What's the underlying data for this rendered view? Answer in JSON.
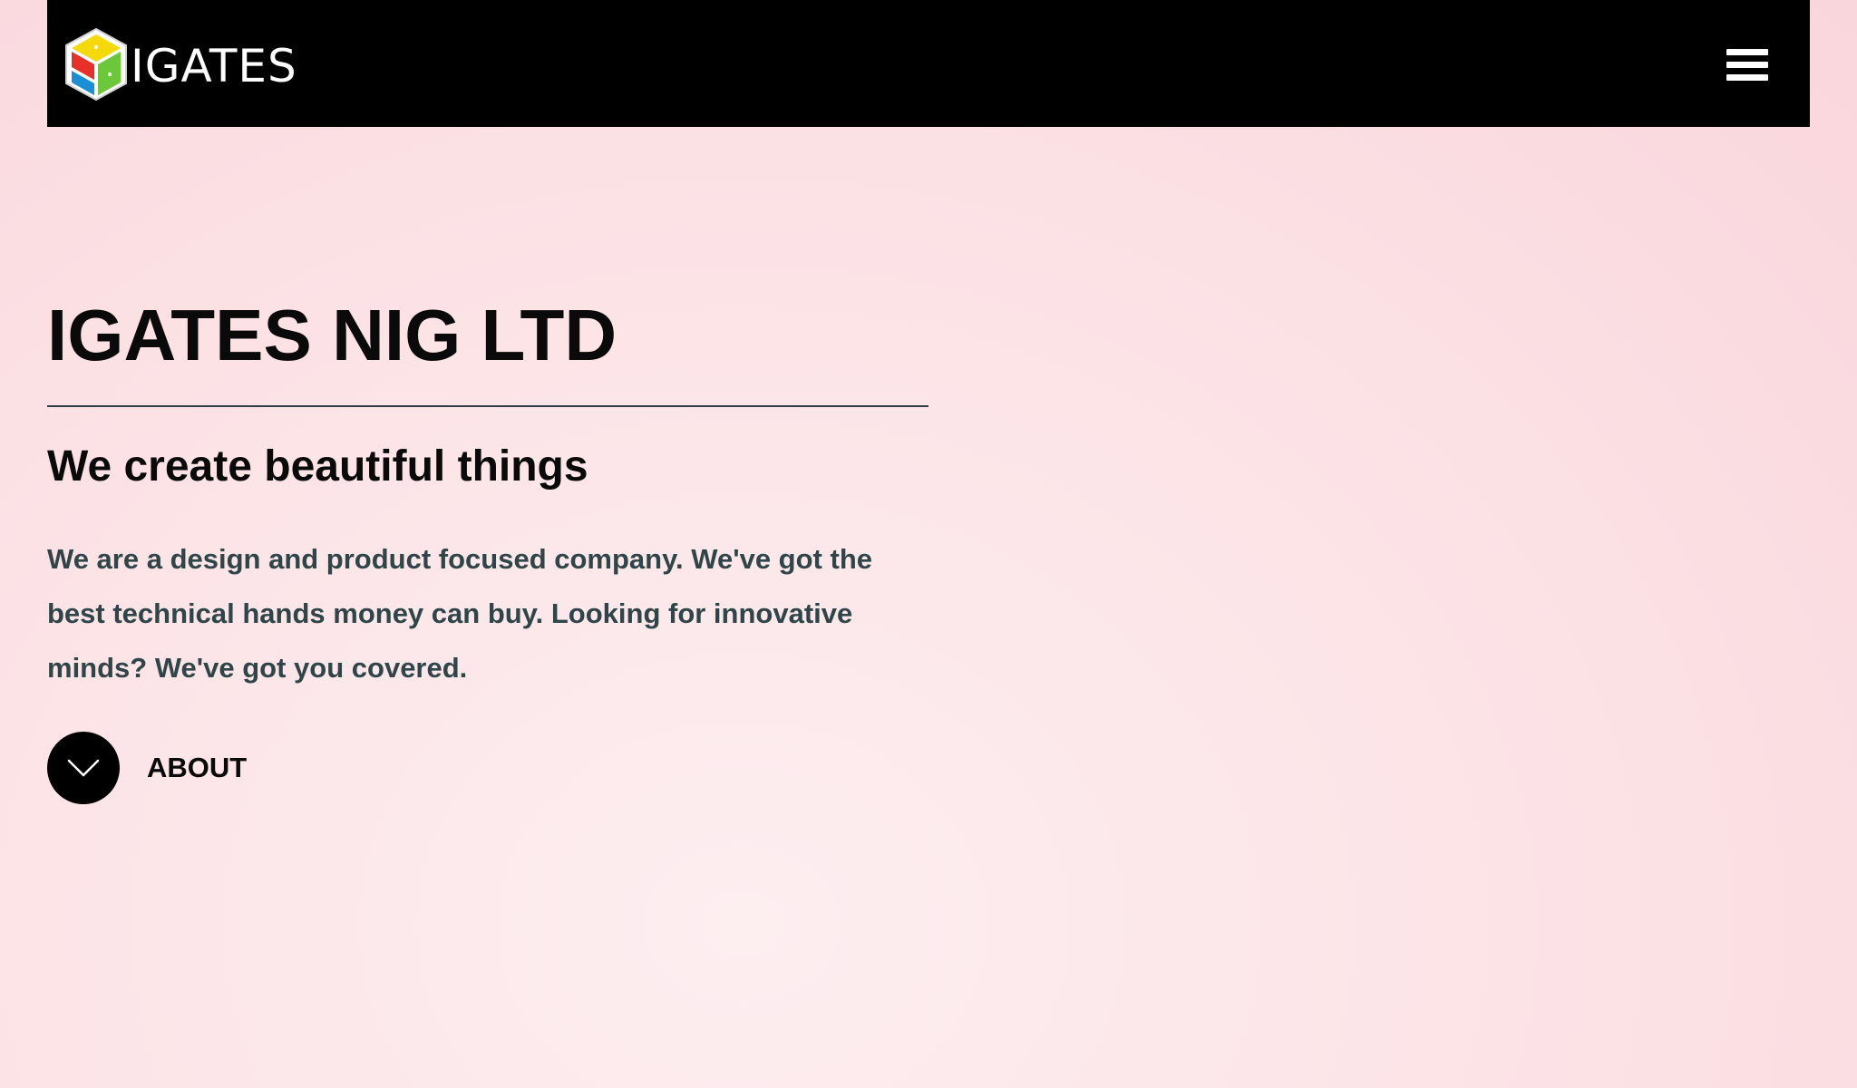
{
  "header": {
    "logo_text": "IGATES",
    "logo_icon": "cube-logo-icon",
    "menu_icon": "hamburger-menu-icon"
  },
  "hero": {
    "title": "IGATES NIG LTD",
    "subtitle": "We create beautiful things",
    "body": "We are a design and product focused company. We've got the best technical hands money can buy. Looking for innovative minds? We've got you covered.",
    "cta_label": "ABOUT",
    "cta_icon": "chevron-down-icon"
  },
  "colors": {
    "navbar_background": "#000000",
    "page_background": "#fce4e7",
    "heading_text": "#0a0a0a",
    "body_text": "#2f4548",
    "logo_top": "#f5d90a",
    "logo_left": "#e8302a",
    "logo_right": "#6cc83a",
    "logo_bottom": "#1a8fd6"
  }
}
